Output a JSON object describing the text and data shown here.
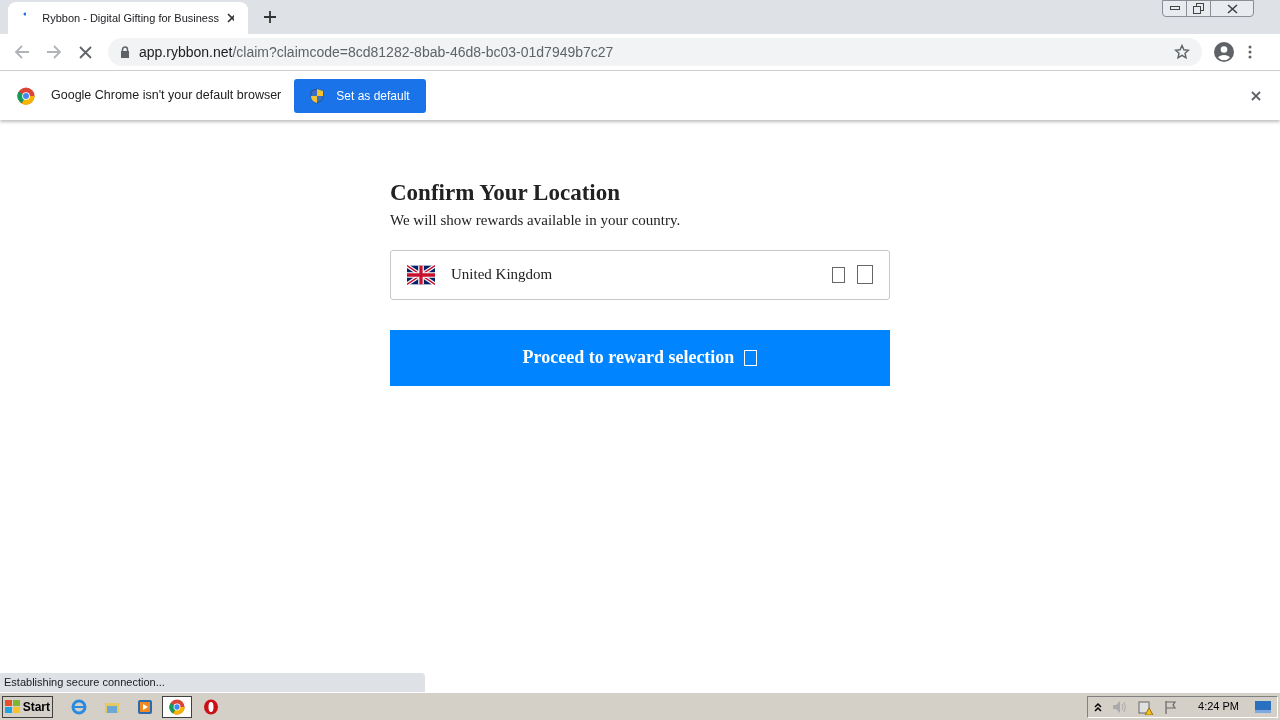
{
  "tab": {
    "title": "Rybbon - Digital Gifting for Business"
  },
  "address_bar": {
    "host": "app.rybbon.net",
    "path": "/claim?claimcode=8cd81282-8bab-46d8-bc03-01d7949b7c27"
  },
  "infobar": {
    "message": "Google Chrome isn't your default browser",
    "button": "Set as default"
  },
  "page": {
    "heading": "Confirm Your Location",
    "subtitle": "We will show rewards available in your country.",
    "country": "United Kingdom",
    "proceed_button": "Proceed to reward selection"
  },
  "status_bubble": "Establishing secure connection...",
  "taskbar": {
    "start": "Start",
    "clock": "4:24 PM"
  }
}
